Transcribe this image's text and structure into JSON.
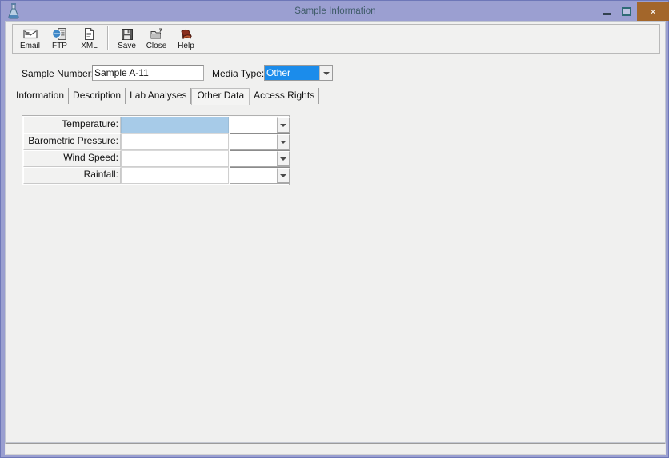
{
  "window": {
    "title": "Sample Information",
    "app_icon": "flask-icon",
    "controls": {
      "minimize": "—",
      "maximize": "□",
      "close": "×"
    }
  },
  "toolbar": {
    "items": [
      {
        "label": "Email",
        "icon": "envelope-icon"
      },
      {
        "label": "FTP",
        "icon": "ftp-server-icon"
      },
      {
        "label": "XML",
        "icon": "document-icon"
      },
      {
        "label": "Save",
        "icon": "floppy-disk-icon"
      },
      {
        "label": "Close",
        "icon": "folder-close-icon"
      },
      {
        "label": "Help",
        "icon": "help-book-icon"
      }
    ],
    "separator_after_index": 2
  },
  "form": {
    "sample_number_label": "Sample Number:",
    "sample_number_value": "Sample A-11",
    "sample_number_placeholder": "",
    "media_type_label": "Media Type:",
    "media_type_value": "Other",
    "media_type_options": [
      "Other"
    ]
  },
  "tabs": [
    {
      "label": "Information",
      "selected": false
    },
    {
      "label": "Description",
      "selected": false
    },
    {
      "label": "Lab Analyses",
      "selected": false
    },
    {
      "label": "Other Data",
      "selected": true
    },
    {
      "label": "Access Rights",
      "selected": false
    }
  ],
  "other_data_grid": {
    "rows": [
      {
        "label": "Temperature:",
        "value": "",
        "unit": "",
        "selected": true
      },
      {
        "label": "Barometric Pressure:",
        "value": "",
        "unit": "",
        "selected": false
      },
      {
        "label": "Wind Speed:",
        "value": "",
        "unit": "",
        "selected": false
      },
      {
        "label": "Rainfall:",
        "value": "",
        "unit": "",
        "selected": false
      }
    ]
  },
  "colors": {
    "titlebar": "#9b9fd1",
    "close_button": "#a3662a",
    "selection_blue": "#1b8ceb",
    "grid_highlight": "#a7cbe8",
    "client_background": "#f0f0ef"
  }
}
